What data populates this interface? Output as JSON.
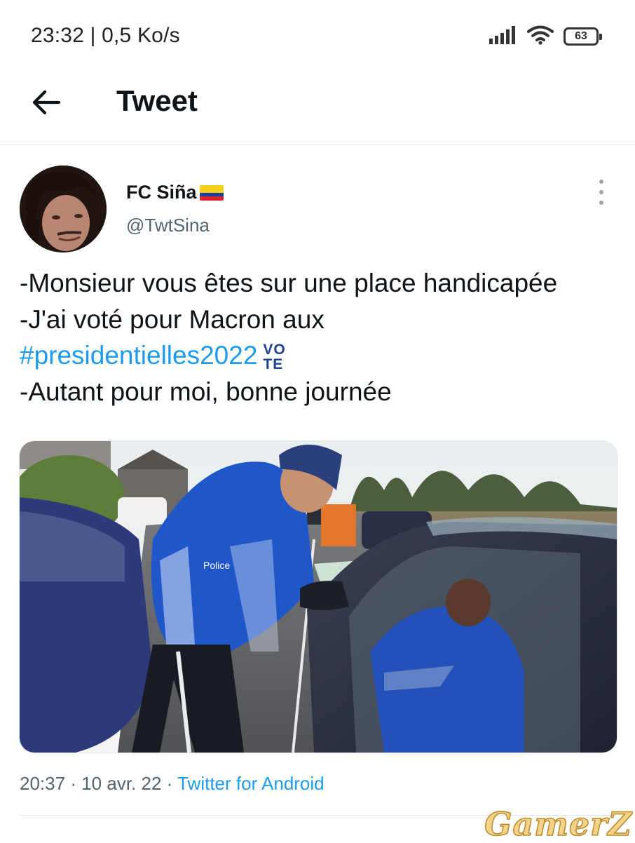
{
  "status_bar": {
    "time": "23:32 | 0,5 Ko/s",
    "battery": "63",
    "icons": [
      "signal-icon",
      "wifi-icon",
      "battery-icon"
    ]
  },
  "header": {
    "title": "Tweet",
    "back_icon": "arrow-left-icon"
  },
  "tweet": {
    "author": {
      "display_name": "FC Siña",
      "flag_colors": [
        "#f7d117",
        "#1d3f9c",
        "#d8262e"
      ],
      "handle": "@TwtSina"
    },
    "text": {
      "line1": "-Monsieur vous êtes sur une place handicapée",
      "line2": "-J'ai voté pour Macron aux",
      "hashtag": "#presidentielles2022",
      "vote_emoji_top": "VO",
      "vote_emoji_bottom": "TE",
      "line4": "-Autant pour moi, bonne journée"
    },
    "media": {
      "badge_text": "Police"
    },
    "meta": {
      "time": "20:37",
      "date": "10 avr. 22",
      "separator": "·",
      "source": "Twitter for Android"
    }
  },
  "watermark": "GamerZ",
  "colors": {
    "link": "#1d9bf0",
    "text": "#0f1419",
    "secondary": "#536471"
  }
}
